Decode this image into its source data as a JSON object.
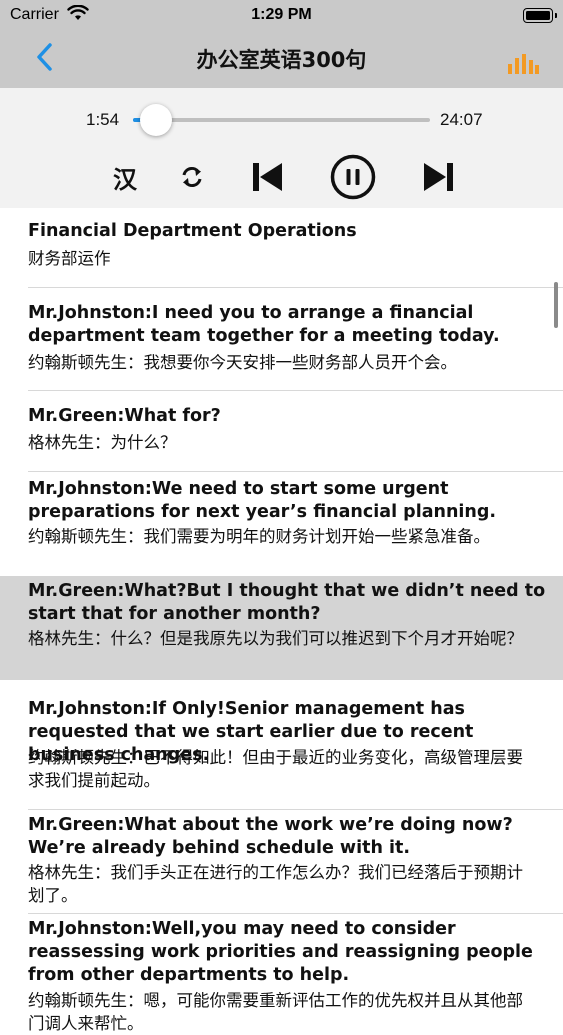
{
  "status": {
    "carrier": "Carrier",
    "time": "1:29 PM"
  },
  "nav": {
    "title": "办公室英语300句"
  },
  "player": {
    "current_time": "1:54",
    "total_time": "24:07",
    "progress": 0.079,
    "lang_toggle_label": "汉"
  },
  "colors": {
    "accent": "#1e90e5",
    "chart_icon": "#f39a23",
    "active_row": "#d4d4d4"
  },
  "lines": [
    {
      "en": "Financial Department Operations",
      "zh": "财务部运作"
    },
    {
      "en": "Mr.Johnston:I need you to arrange a financial department team together for a meeting today.",
      "zh": "约翰斯顿先生：我想要你今天安排一些财务部人员开个会。"
    },
    {
      "en": "Mr.Green:What for?",
      "zh": "格林先生：为什么？"
    },
    {
      "en": "Mr.Johnston:We need to start some urgent preparations for next year’s financial planning.",
      "zh": "约翰斯顿先生：我们需要为明年的财务计划开始一些紧急准备。"
    },
    {
      "en": "Mr.Green:What?But I thought that we didn’t need to start that for another month?",
      "zh": "格林先生：什么？但是我原先以为我们可以推迟到下个月才开始呢？"
    },
    {
      "en": "Mr.Johnston:If Only!Senior management has requested that we start earlier due to recent business changes.",
      "zh": "约翰斯顿先生：巴不得如此！但由于最近的业务变化，高级管理层要求我们提前起动。"
    },
    {
      "en": "Mr.Green:What about the work we’re doing now?We’re already behind schedule with it.",
      "zh": "格林先生：我们手头正在进行的工作怎么办？我们已经落后于预期计划了。"
    },
    {
      "en": "Mr.Johnston:Well,you may need to consider reassessing work priorities and reassigning people from other departments to help.",
      "zh": "约翰斯顿先生：嗯，可能你需要重新评估工作的优先权并且从其他部门调人来帮忙。"
    }
  ]
}
